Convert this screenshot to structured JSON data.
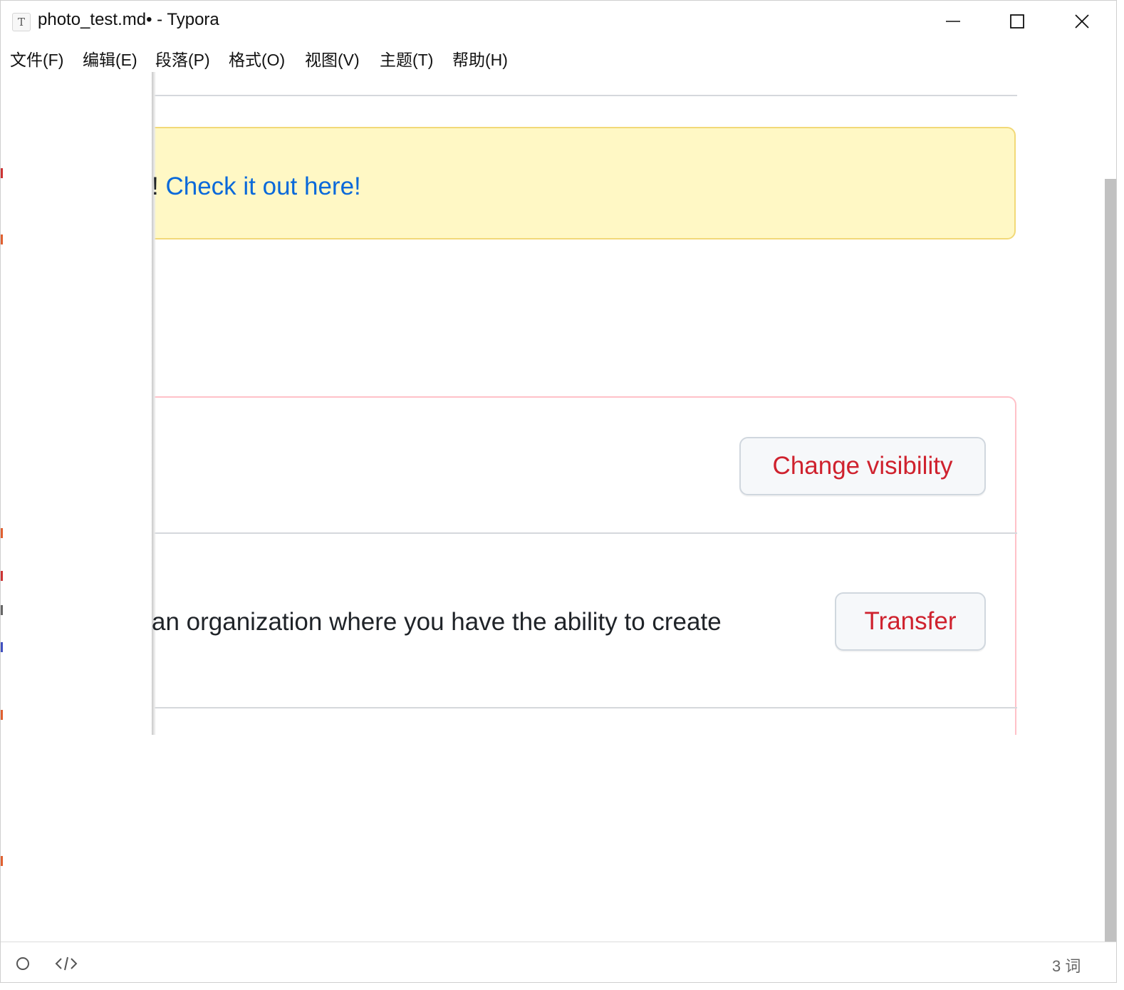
{
  "window": {
    "title": "photo_test.md• - Typora",
    "app_icon_letter": "T"
  },
  "menu": [
    {
      "label": "文件(F)"
    },
    {
      "label": "编辑(E)"
    },
    {
      "label": "段落(P)"
    },
    {
      "label": "格式(O)"
    },
    {
      "label": "视图(V)"
    },
    {
      "label": "主题(T)"
    },
    {
      "label": "帮助(H)"
    }
  ],
  "content": {
    "alert_prefix": "! ",
    "alert_link": "Check it out here!",
    "change_visibility_label": "Change visibility",
    "transfer_description": "an organization where you have the ability to create",
    "transfer_label": "Transfer"
  },
  "status": {
    "word_count": "3 词"
  },
  "colors": {
    "alert_bg": "#fff8c5",
    "link": "#0969da",
    "danger_text": "#cf222e",
    "danger_border": "#ffc1c8"
  },
  "icons": {
    "status_left": "circle-icon",
    "status_code": "code-icon"
  }
}
